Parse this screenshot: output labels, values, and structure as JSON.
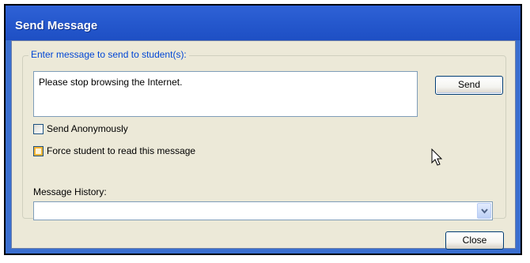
{
  "window": {
    "title": "Send Message"
  },
  "group": {
    "legend": "Enter message to send to student(s):"
  },
  "message": {
    "text": "Please stop browsing the Internet."
  },
  "buttons": {
    "send": "Send",
    "close": "Close"
  },
  "options": {
    "anonymous_label": "Send Anonymously",
    "anonymous_checked": false,
    "force_label": "Force student to read this message",
    "force_checked": false
  },
  "history": {
    "label": "Message History:",
    "value": ""
  },
  "icons": {
    "dropdown": "chevron-down-icon",
    "cursor": "mouse-pointer-icon"
  },
  "colors": {
    "title_bar": "#2558cd",
    "dialog_bg": "#ece9d8",
    "legend_text": "#0046d5"
  }
}
